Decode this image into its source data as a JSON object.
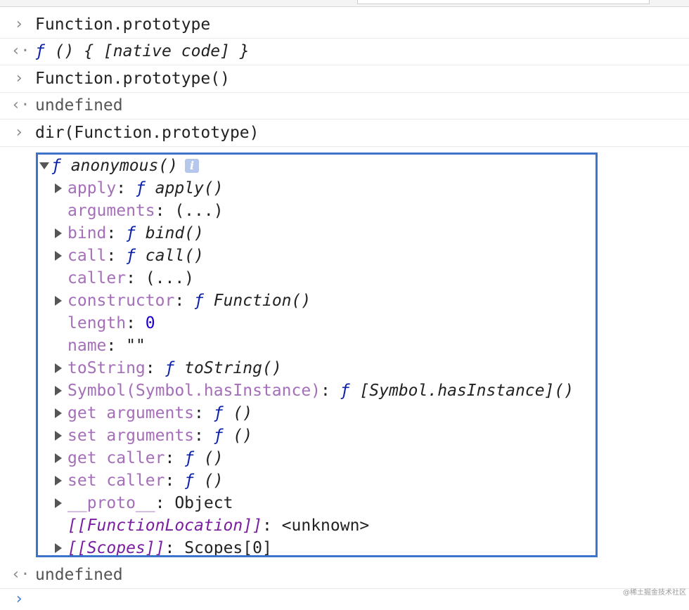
{
  "console": {
    "input_glyph": "›",
    "output_glyph": "‹·",
    "prompt_glyph": "›",
    "entries": [
      {
        "input": "Function.prototype"
      },
      {
        "output_f": "ƒ",
        "output_sig": " () { [native code] }"
      },
      {
        "input": "Function.prototype()"
      },
      {
        "output": "undefined"
      },
      {
        "input": "dir(Function.prototype)"
      }
    ],
    "final_output": "undefined"
  },
  "dir_object": {
    "header_f": "ƒ",
    "header_name": " anonymous()",
    "info_label": "i",
    "props": [
      {
        "key": "apply",
        "sep": ": ",
        "f": "ƒ",
        "sig": " apply()",
        "expandable": true
      },
      {
        "key": "arguments",
        "sep": ": ",
        "val": "(...)",
        "expandable": false
      },
      {
        "key": "bind",
        "sep": ": ",
        "f": "ƒ",
        "sig": " bind()",
        "expandable": true
      },
      {
        "key": "call",
        "sep": ": ",
        "f": "ƒ",
        "sig": " call()",
        "expandable": true
      },
      {
        "key": "caller",
        "sep": ": ",
        "val": "(...)",
        "expandable": false
      },
      {
        "key": "constructor",
        "sep": ": ",
        "f": "ƒ",
        "sig": " Function()",
        "expandable": true
      },
      {
        "key": "length",
        "sep": ": ",
        "num": "0",
        "expandable": false
      },
      {
        "key": "name",
        "sep": ": ",
        "val": "\"\"",
        "expandable": false
      },
      {
        "key": "toString",
        "sep": ": ",
        "f": "ƒ",
        "sig": " toString()",
        "expandable": true
      },
      {
        "key": "Symbol(Symbol.hasInstance)",
        "sep": ": ",
        "f": "ƒ",
        "sig": " [Symbol.hasInstance]()",
        "expandable": true
      },
      {
        "key": "get arguments",
        "sep": ": ",
        "f": "ƒ",
        "sig": " ()",
        "expandable": true
      },
      {
        "key": "set arguments",
        "sep": ": ",
        "f": "ƒ",
        "sig": " ()",
        "expandable": true
      },
      {
        "key": "get caller",
        "sep": ": ",
        "f": "ƒ",
        "sig": " ()",
        "expandable": true
      },
      {
        "key": "set caller",
        "sep": ": ",
        "f": "ƒ",
        "sig": " ()",
        "expandable": true
      },
      {
        "key": "__proto__",
        "sep": ": ",
        "val": "Object",
        "expandable": true
      },
      {
        "key": "[[FunctionLocation]]",
        "sep": ": ",
        "val": "<unknown>",
        "expandable": false,
        "internal": true
      },
      {
        "key": "[[Scopes]]",
        "sep": ": ",
        "val": "Scopes[0]",
        "expandable": true,
        "internal": true
      }
    ]
  },
  "watermark": "@稀土掘金技术社区",
  "colors": {
    "outline": "#3d74c9",
    "property_key": "#a46fb8",
    "internal_key": "#7a1ea1",
    "function_keyword": "#0d22aa",
    "number": "#1c00cf"
  }
}
